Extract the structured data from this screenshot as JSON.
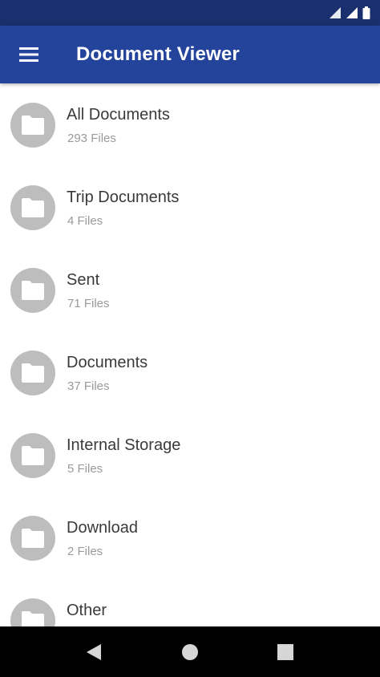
{
  "app": {
    "title": "Document Viewer"
  },
  "colors": {
    "status_bar": "#1a2f6e",
    "app_bar": "#24449b",
    "folder_circle": "#bdbdbd",
    "folder_glyph": "#ffffff",
    "nav_bar": "#000000",
    "nav_glyph": "#d6d6d6"
  },
  "icons": {
    "menu": "hamburger-menu-icon",
    "folder": "folder-icon",
    "back": "back-triangle-icon",
    "home": "home-circle-icon",
    "recents": "recents-square-icon"
  },
  "folders": [
    {
      "name": "All Documents",
      "count": "293 Files"
    },
    {
      "name": "Trip Documents",
      "count": "4 Files"
    },
    {
      "name": "Sent",
      "count": "71 Files"
    },
    {
      "name": "Documents",
      "count": "37 Files"
    },
    {
      "name": "Internal Storage",
      "count": "5 Files"
    },
    {
      "name": "Download",
      "count": "2 Files"
    },
    {
      "name": "Other",
      "count": ""
    }
  ]
}
